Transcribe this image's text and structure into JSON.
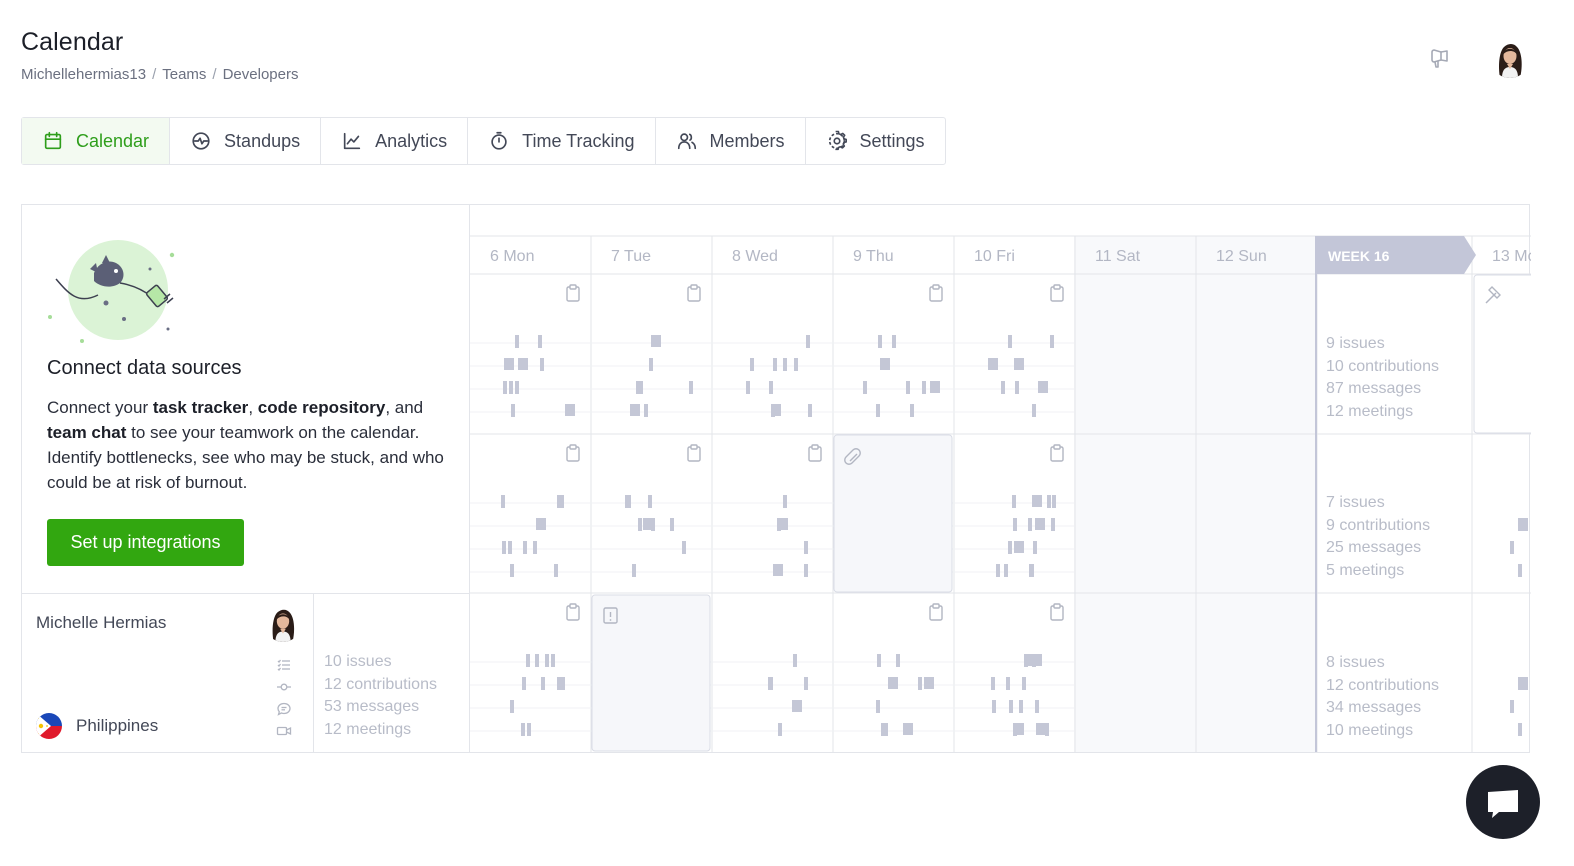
{
  "header": {
    "title": "Calendar",
    "breadcrumb": [
      "Michellehermias13",
      "Teams",
      "Developers"
    ],
    "breadcrumb_separator": "/"
  },
  "tabs": [
    {
      "label": "Calendar",
      "icon": "calendar-icon",
      "active": true
    },
    {
      "label": "Standups",
      "icon": "standup-icon",
      "active": false
    },
    {
      "label": "Analytics",
      "icon": "analytics-icon",
      "active": false
    },
    {
      "label": "Time Tracking",
      "icon": "stopwatch-icon",
      "active": false
    },
    {
      "label": "Members",
      "icon": "members-icon",
      "active": false
    },
    {
      "label": "Settings",
      "icon": "gear-icon",
      "active": false
    }
  ],
  "connect": {
    "title": "Connect data sources",
    "text_parts": [
      "Connect your ",
      "task tracker",
      ", ",
      "code repository",
      ", and ",
      "team chat",
      " to see your teamwork on the calendar. Identify bottlenecks, see who may be stuck, and who could be at risk of burnout."
    ],
    "button_label": "Set up integrations"
  },
  "calendar": {
    "days": [
      {
        "num": "6",
        "name": "Mon"
      },
      {
        "num": "7",
        "name": "Tue"
      },
      {
        "num": "8",
        "name": "Wed"
      },
      {
        "num": "9",
        "name": "Thu"
      },
      {
        "num": "10",
        "name": "Fri"
      },
      {
        "num": "11",
        "name": "Sat"
      },
      {
        "num": "12",
        "name": "Sun"
      }
    ],
    "week_label": "WEEK 16",
    "next_day": {
      "num": "13",
      "name": "Mon"
    },
    "week_stats": [
      [
        "9 issues",
        "10 contributions",
        "87 messages",
        "12 meetings"
      ],
      [
        "7 issues",
        "9 contributions",
        "25 messages",
        "5 meetings"
      ],
      [
        "8 issues",
        "12 contributions",
        "34 messages",
        "10 meetings"
      ]
    ]
  },
  "member": {
    "name": "Michelle Hermias",
    "country": "Philippines",
    "stats": [
      "10 issues",
      "12 contributions",
      "53 messages",
      "12 meetings"
    ]
  },
  "colors": {
    "accent": "#32a710",
    "active_tab_text": "#2e9e1b",
    "activity_bar": "#c4c7d6",
    "week_header": "#c3c6d8",
    "stat_text": "#b8bcc8"
  }
}
